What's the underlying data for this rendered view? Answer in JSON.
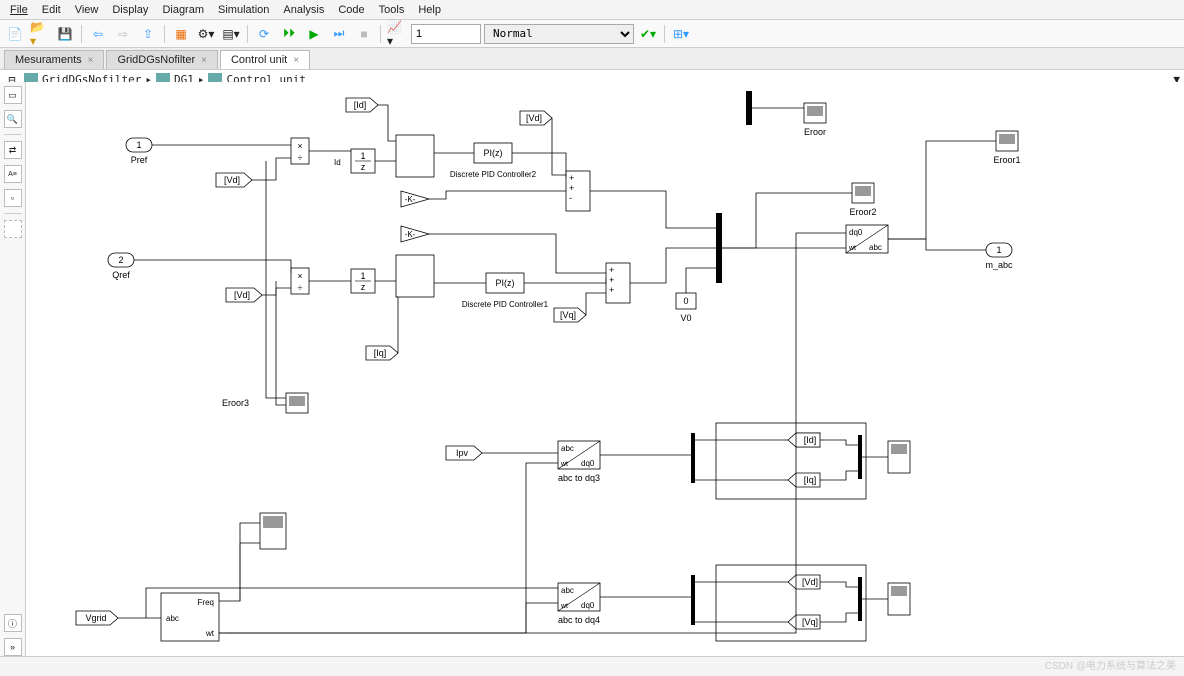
{
  "menu": {
    "file": "File",
    "edit": "Edit",
    "view": "View",
    "display": "Display",
    "diagram": "Diagram",
    "simulation": "Simulation",
    "analysis": "Analysis",
    "code": "Code",
    "tools": "Tools",
    "help": "Help"
  },
  "toolbar": {
    "step": "1",
    "mode": "Normal"
  },
  "tabs": [
    {
      "label": "Mesuraments",
      "active": false,
      "close": "×"
    },
    {
      "label": "GridDGsNofilter",
      "active": false,
      "close": "×"
    },
    {
      "label": "Control unit",
      "active": true,
      "close": "×"
    }
  ],
  "breadcrumb": [
    "GridDGsNofilter",
    "DG1",
    "Control unit"
  ],
  "blocks": {
    "pref": "Pref",
    "qref": "Qref",
    "pref_num": "1",
    "qref_num": "2",
    "vd1": "[Vd]",
    "vd2": "[Vd]",
    "vd3": "[Vd]",
    "vq_tag": "[Vq]",
    "id": "[Id]",
    "iq": "[Iq]",
    "id_out": "[Id]",
    "iq_out": "[Iq]",
    "vd_out": "[Vd]",
    "vq_out": "[Vq]",
    "int1": "1\\z",
    "int2": "1\\z",
    "k1": "-K-",
    "k2": "-K-",
    "pi1": "PI(z)",
    "pi2": "PI(z)",
    "pid1_label": "Discrete PID Controller1",
    "pid2_label": "Discrete PID Controller2",
    "v0": "0",
    "v0_label": "V0",
    "const_x": "×",
    "const_x2": "×",
    "ipv": "Ipv",
    "vgrid": "Vgrid",
    "abc1_top": "abc",
    "abc1_bot": "dq0",
    "abc3_label": "abc to dq3",
    "abc4_label": "abc to dq4",
    "freq_blk_top": "Freq",
    "freq_blk_mid": "abc",
    "freq_blk_bot": "wt",
    "dq_abc_top": "dq0",
    "dq_abc_bot": "abc",
    "dq_abc_wt": "wt",
    "abc_wt": "wt",
    "out1": "1",
    "out1_label": "m_abc",
    "scope_eroor": "Eroor",
    "scope_eroor1": "Eroor1",
    "scope_eroor2": "Eroor2",
    "scope_eroor3": "Eroor3"
  },
  "watermark": "CSDN @电力系统与算法之美",
  "collapse": "»"
}
